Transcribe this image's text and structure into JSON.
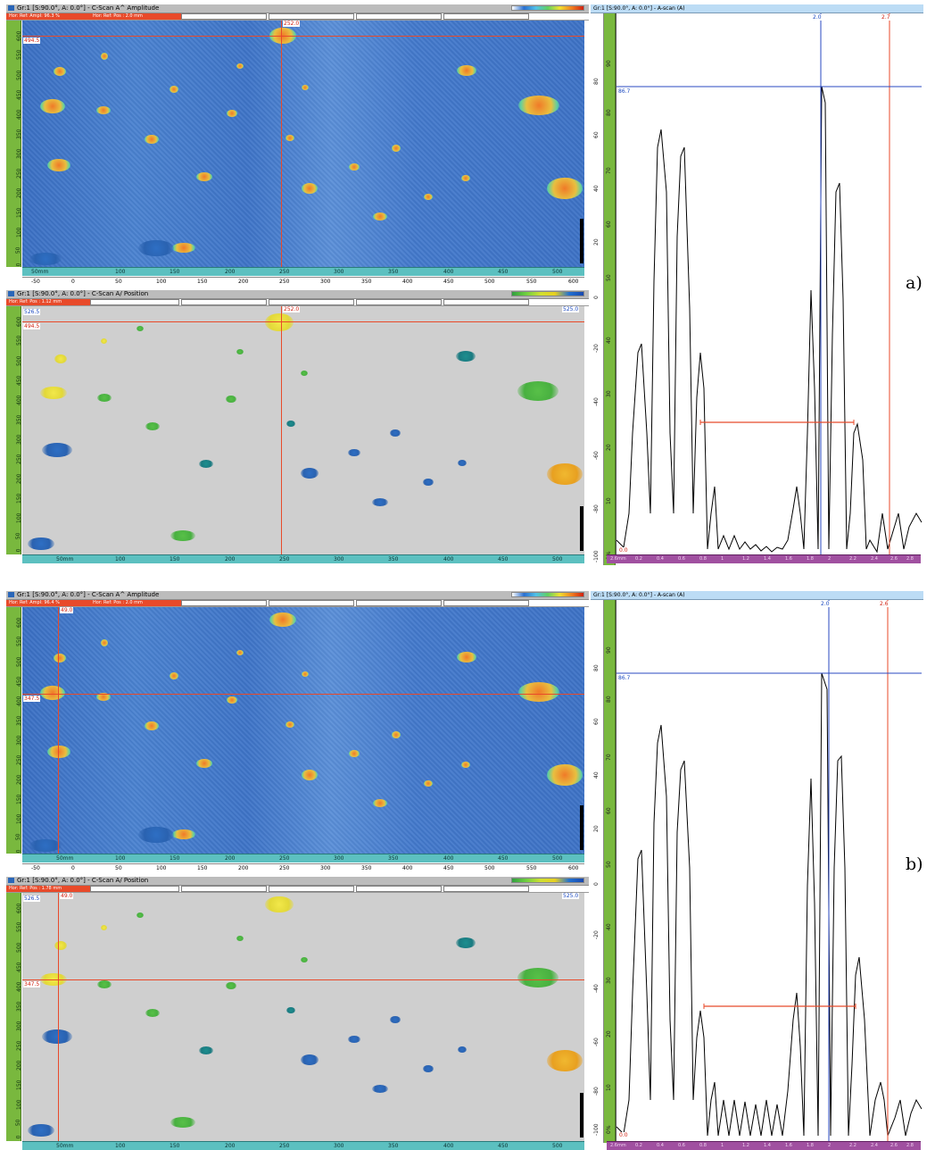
{
  "panel_a": {
    "amp": {
      "title": "Gr:1 [S:90.0°, A: 0.0°] - C-Scan A^ Amplitude",
      "stat1": "Hor: Ref: Ampl: 96.3 %",
      "stat2": "Hor: Ref: Pos : 2.0 mm",
      "cursor_x": "252.0",
      "cursor_y": "494.5",
      "hruler_top": [
        "50mm",
        "100",
        "150",
        "200",
        "250",
        "300",
        "350",
        "400",
        "450",
        "500"
      ],
      "hruler_bot": [
        "-50",
        "0",
        "50",
        "100",
        "150",
        "200",
        "250",
        "300",
        "350",
        "400",
        "450",
        "500",
        "550",
        "600"
      ],
      "vruler": [
        "600",
        "550",
        "500",
        "450",
        "400",
        "350",
        "300",
        "250",
        "200",
        "150",
        "100",
        "50",
        "0"
      ]
    },
    "pos": {
      "title": "Gr:1 [S:90.0°, A: 0.0°] - C-Scan A/ Position",
      "stat1": "Hor: Ref: Pos : 1.12 mm",
      "cursor_x": "252.0",
      "cursor_y": "494.5",
      "blue_left": "526.5",
      "blue_right": "525.0",
      "hruler": [
        "50mm",
        "100",
        "150",
        "200",
        "250",
        "300",
        "350",
        "400",
        "450",
        "500"
      ],
      "vruler": [
        "600",
        "550",
        "500",
        "450",
        "400",
        "350",
        "300",
        "250",
        "200",
        "150",
        "100",
        "50",
        "0"
      ]
    },
    "ascan": {
      "title": "Gr:1 [S:90.0°, A: 0.0°] - A-scan (A)",
      "gate_blue": "2.0",
      "gate_red": "2.7",
      "level": "86.7",
      "zero": "0.0",
      "vruler1": [
        "80",
        "60",
        "40",
        "20",
        "0",
        "-20",
        "-40",
        "-60",
        "-80",
        "-100"
      ],
      "vruler2": [
        "90",
        "80",
        "70",
        "60",
        "50",
        "40",
        "30",
        "20",
        "10",
        "0%"
      ],
      "bottom": [
        "2.6mm",
        "0.2",
        "0.4",
        "0.6",
        "0.8",
        "1",
        "1.2",
        "1.4",
        "1.6",
        "1.8",
        "2",
        "2.2",
        "2.4",
        "2.6",
        "2.8"
      ]
    },
    "label": "a)"
  },
  "panel_b": {
    "amp": {
      "title": "Gr:1 [S:90.0°, A: 0.0°] - C-Scan A^ Amplitude",
      "stat1": "Hor: Ref: Ampl: 96.4 %",
      "stat2": "Hor: Ref: Pos : 2.0 mm",
      "cursor_x": "49.0",
      "cursor_y": "347.5",
      "hruler_top": [
        "50mm",
        "100",
        "150",
        "200",
        "250",
        "300",
        "350",
        "400",
        "450",
        "500"
      ],
      "hruler_bot": [
        "-50",
        "0",
        "50",
        "100",
        "150",
        "200",
        "250",
        "300",
        "350",
        "400",
        "450",
        "500",
        "550",
        "600"
      ],
      "vruler": [
        "600",
        "550",
        "500",
        "450",
        "400",
        "350",
        "300",
        "250",
        "200",
        "150",
        "100",
        "50",
        "0"
      ]
    },
    "pos": {
      "title": "Gr:1 [S:90.0°, A: 0.0°] - C-Scan A/ Position",
      "stat1": "Hor: Ref: Pos : 1.78 mm",
      "cursor_x": "49.0",
      "cursor_y": "347.5",
      "blue_left": "526.5",
      "blue_right": "525.0",
      "hruler": [
        "50mm",
        "100",
        "150",
        "200",
        "250",
        "300",
        "350",
        "400",
        "450",
        "500"
      ],
      "vruler": [
        "600",
        "550",
        "500",
        "450",
        "400",
        "350",
        "300",
        "250",
        "200",
        "150",
        "100",
        "50",
        "0"
      ]
    },
    "ascan": {
      "title": "Gr:1 [S:90.0°, A: 0.0°] - A-scan (A)",
      "gate_blue": "2.0",
      "gate_red": "2.6",
      "level": "86.7",
      "zero": "0.0",
      "vruler1": [
        "80",
        "60",
        "40",
        "20",
        "0",
        "-20",
        "-40",
        "-60",
        "-80",
        "-100"
      ],
      "vruler2": [
        "90",
        "80",
        "70",
        "60",
        "50",
        "40",
        "30",
        "20",
        "10",
        "0%"
      ],
      "bottom": [
        "2.6mm",
        "0.2",
        "0.4",
        "0.6",
        "0.8",
        "1",
        "1.2",
        "1.4",
        "1.6",
        "1.8",
        "2",
        "2.2",
        "2.4",
        "2.6",
        "2.8"
      ]
    },
    "label": "b)"
  },
  "colors": {
    "cursor": "#e84a2a",
    "gate_blue": "#2a48c0",
    "ruler_green": "#79b83e",
    "ruler_cyan": "#5cc0c0",
    "ruler_purple": "#a050a0"
  }
}
